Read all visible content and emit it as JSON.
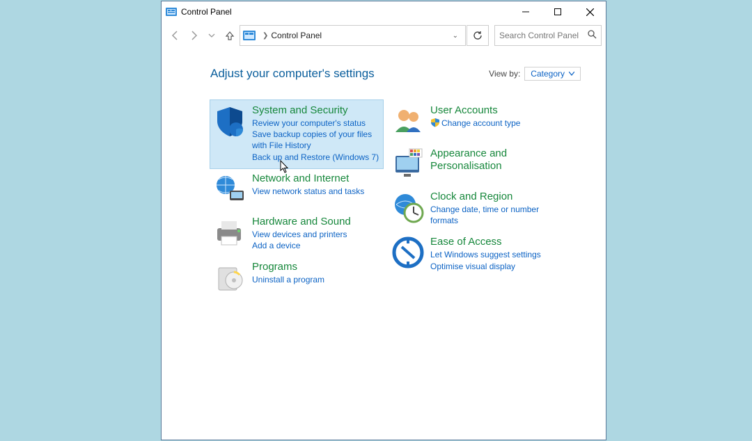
{
  "window": {
    "title": "Control Panel"
  },
  "address": {
    "location": "Control Panel"
  },
  "search": {
    "placeholder": "Search Control Panel"
  },
  "heading": "Adjust your computer's settings",
  "viewby": {
    "label": "View by:",
    "value": "Category"
  },
  "left": [
    {
      "title": "System and Security",
      "links": [
        "Review your computer's status",
        "Save backup copies of your files with File History",
        "Back up and Restore (Windows 7)"
      ]
    },
    {
      "title": "Network and Internet",
      "links": [
        "View network status and tasks"
      ]
    },
    {
      "title": "Hardware and Sound",
      "links": [
        "View devices and printers",
        "Add a device"
      ]
    },
    {
      "title": "Programs",
      "links": [
        "Uninstall a program"
      ]
    }
  ],
  "right": [
    {
      "title": "User Accounts",
      "links": [
        "Change account type"
      ]
    },
    {
      "title": "Appearance and Personalisation",
      "links": []
    },
    {
      "title": "Clock and Region",
      "links": [
        "Change date, time or number formats"
      ]
    },
    {
      "title": "Ease of Access",
      "links": [
        "Let Windows suggest settings",
        "Optimise visual display"
      ]
    }
  ]
}
